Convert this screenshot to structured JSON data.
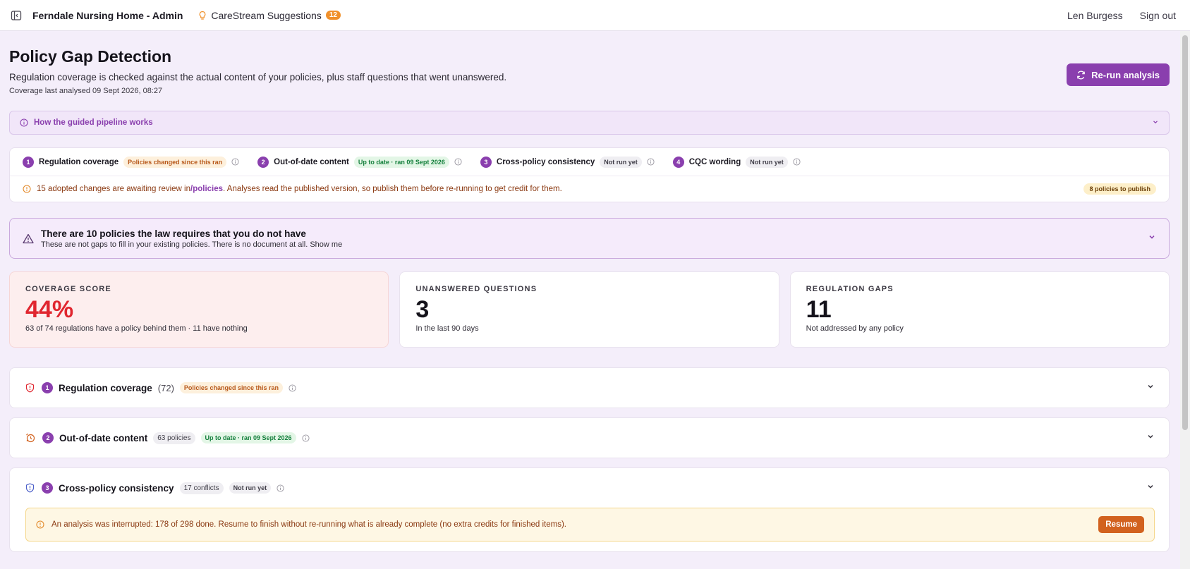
{
  "topbar": {
    "app_title": "Ferndale Nursing Home - Admin",
    "suggestions_label": "CareStream Suggestions",
    "suggestions_count": "12",
    "user_name": "Len Burgess",
    "sign_out": "Sign out"
  },
  "header": {
    "title": "Policy Gap Detection",
    "subtitle": "Regulation coverage is checked against the actual content of your policies, plus staff questions that went unanswered.",
    "analysed": "Coverage last analysed 09 Sept 2026, 08:27",
    "rerun_label": "Re-run analysis"
  },
  "how_panel": {
    "label": "How the guided pipeline works"
  },
  "pipeline": {
    "steps": [
      {
        "num": "1",
        "label": "Regulation coverage",
        "badge": "Policies changed since this ran",
        "tone": "orange"
      },
      {
        "num": "2",
        "label": "Out-of-date content",
        "badge": "Up to date · ran 09 Sept 2026",
        "tone": "green"
      },
      {
        "num": "3",
        "label": "Cross-policy consistency",
        "badge": "Not run yet",
        "tone": "gray"
      },
      {
        "num": "4",
        "label": "CQC wording",
        "badge": "Not run yet",
        "tone": "gray"
      }
    ],
    "note_pre": "15 adopted changes are awaiting review in ",
    "note_link": "/policies",
    "note_post": ". Analyses read the published version, so publish them before re-running to get credit for them.",
    "publish_badge": "8 policies to publish"
  },
  "missing": {
    "title": "There are 10 policies the law requires that you do not have",
    "subtitle": "These are not gaps to fill in your existing policies. There is no document at all. Show me"
  },
  "stats": [
    {
      "label": "COVERAGE SCORE",
      "value": "44%",
      "sub": "63 of 74 regulations have a policy behind them · 11 have nothing"
    },
    {
      "label": "UNANSWERED QUESTIONS",
      "value": "3",
      "sub": "In the last 90 days"
    },
    {
      "label": "REGULATION GAPS",
      "value": "11",
      "sub": "Not addressed by any policy"
    }
  ],
  "sections": [
    {
      "num": "1",
      "title": "Regulation coverage",
      "count": "(72)",
      "badge": "Policies changed since this ran",
      "tone": "orange"
    },
    {
      "num": "2",
      "title": "Out-of-date content",
      "count": "63 policies",
      "badge": "Up to date · ran 09 Sept 2026",
      "tone": "green"
    },
    {
      "num": "3",
      "title": "Cross-policy consistency",
      "count": "17 conflicts",
      "badge": "Not run yet",
      "tone": "gray"
    }
  ],
  "interrupt": {
    "text": "An analysis was interrupted: 178 of 298 done. Resume to finish without re-running what is already complete (no extra credits for finished items).",
    "resume_label": "Resume"
  },
  "colors": {
    "accent": "#8a3fae",
    "danger": "#e0262f",
    "warning": "#d2621f",
    "success": "#15803d"
  }
}
